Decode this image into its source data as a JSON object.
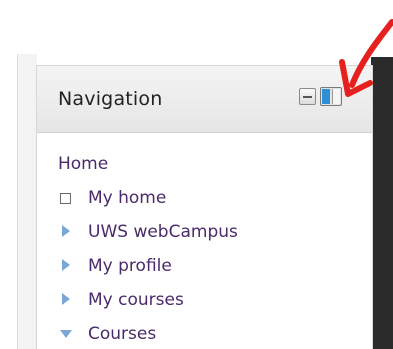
{
  "block": {
    "title": "Navigation",
    "controls": {
      "hide_icon": "minus-icon",
      "dock_icon": "dock-icon"
    }
  },
  "nav": {
    "home": "Home",
    "items": [
      {
        "label": "My home",
        "icon": "square-icon"
      },
      {
        "label": "UWS webCampus",
        "icon": "triangle-right-icon"
      },
      {
        "label": "My profile",
        "icon": "triangle-right-icon"
      },
      {
        "label": "My courses",
        "icon": "triangle-right-icon"
      },
      {
        "label": "Courses",
        "icon": "triangle-down-icon"
      }
    ]
  },
  "colors": {
    "link": "#4a2a6b",
    "expander": "#7ba7d6",
    "dock_active": "#2f8fd6",
    "annotation": "#e5201f"
  }
}
